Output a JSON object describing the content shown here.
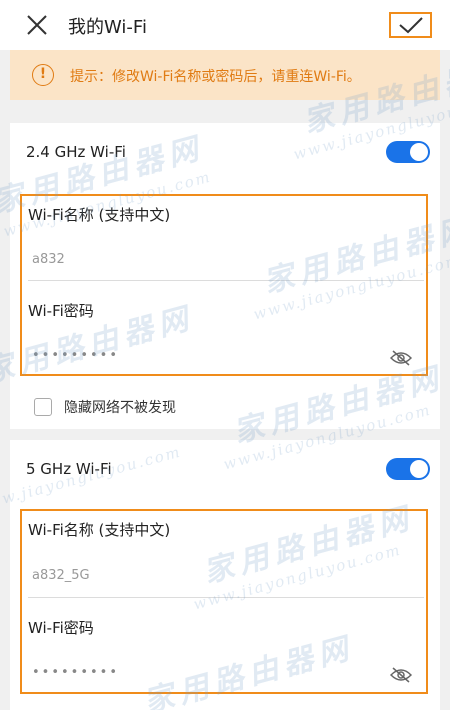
{
  "header": {
    "title": "我的Wi-Fi",
    "close_icon": "close-icon",
    "confirm_icon": "check-icon"
  },
  "notice": {
    "icon": "info-icon",
    "icon_glyph": "!",
    "text": "提示：修改Wi-Fi名称或密码后，请重连Wi-Fi。"
  },
  "band_24": {
    "label": "2.4 GHz Wi-Fi",
    "enabled": true,
    "name_label": "Wi-Fi名称 (支持中文)",
    "name_value": "a832",
    "password_label": "Wi-Fi密码",
    "password_value": "•••••••••",
    "hide_network_label": "隐藏网络不被发现",
    "hide_network_checked": false
  },
  "band_5": {
    "label": "5 GHz Wi-Fi",
    "enabled": true,
    "name_label": "Wi-Fi名称 (支持中文)",
    "name_value": "a832_5G",
    "password_label": "Wi-Fi密码",
    "password_value": "•••••••••"
  },
  "watermark": {
    "cn": "家用路由器网",
    "en": "www.jiayongluyou.com"
  },
  "colors": {
    "accent_orange": "#f08c1a",
    "notice_bg": "#fbe4c7",
    "notice_text": "#e07b13",
    "toggle_on": "#1a73e8"
  }
}
